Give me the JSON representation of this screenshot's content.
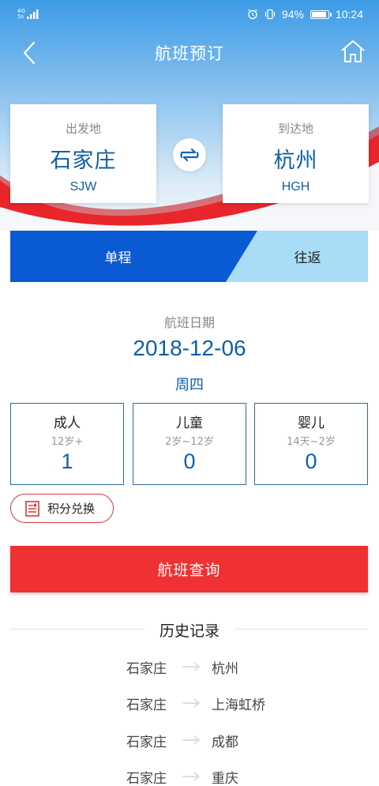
{
  "status": {
    "network_top": "4G",
    "network_bottom": "5s",
    "battery": "94%",
    "time": "10:24"
  },
  "nav": {
    "title": "航班预订"
  },
  "departure": {
    "caption": "出发地",
    "city": "石家庄",
    "code": "SJW"
  },
  "arrival": {
    "caption": "到达地",
    "city": "杭州",
    "code": "HGH"
  },
  "trip_tabs": {
    "one_way": "单程",
    "round_trip": "往返",
    "selected": "one_way"
  },
  "date": {
    "label": "航班日期",
    "value": "2018-12-06",
    "weekday": "周四"
  },
  "passengers": [
    {
      "title": "成人",
      "age": "12岁+",
      "count": "1"
    },
    {
      "title": "儿童",
      "age": "2岁~12岁",
      "count": "0"
    },
    {
      "title": "婴儿",
      "age": "14天~2岁",
      "count": "0"
    }
  ],
  "points": {
    "label": "积分兑换"
  },
  "search": {
    "label": "航班查询"
  },
  "history": {
    "title": "历史记录",
    "items": [
      {
        "from": "石家庄",
        "to": "杭州"
      },
      {
        "from": "石家庄",
        "to": "上海虹桥"
      },
      {
        "from": "石家庄",
        "to": "成都"
      },
      {
        "from": "石家庄",
        "to": "重庆"
      }
    ]
  },
  "colors": {
    "primary_blue": "#0d5fa8",
    "tab_active": "#0a5ad4",
    "tab_inactive": "#a9dcf7",
    "search_red": "#f03134",
    "swoosh_red": "#e8262b"
  }
}
